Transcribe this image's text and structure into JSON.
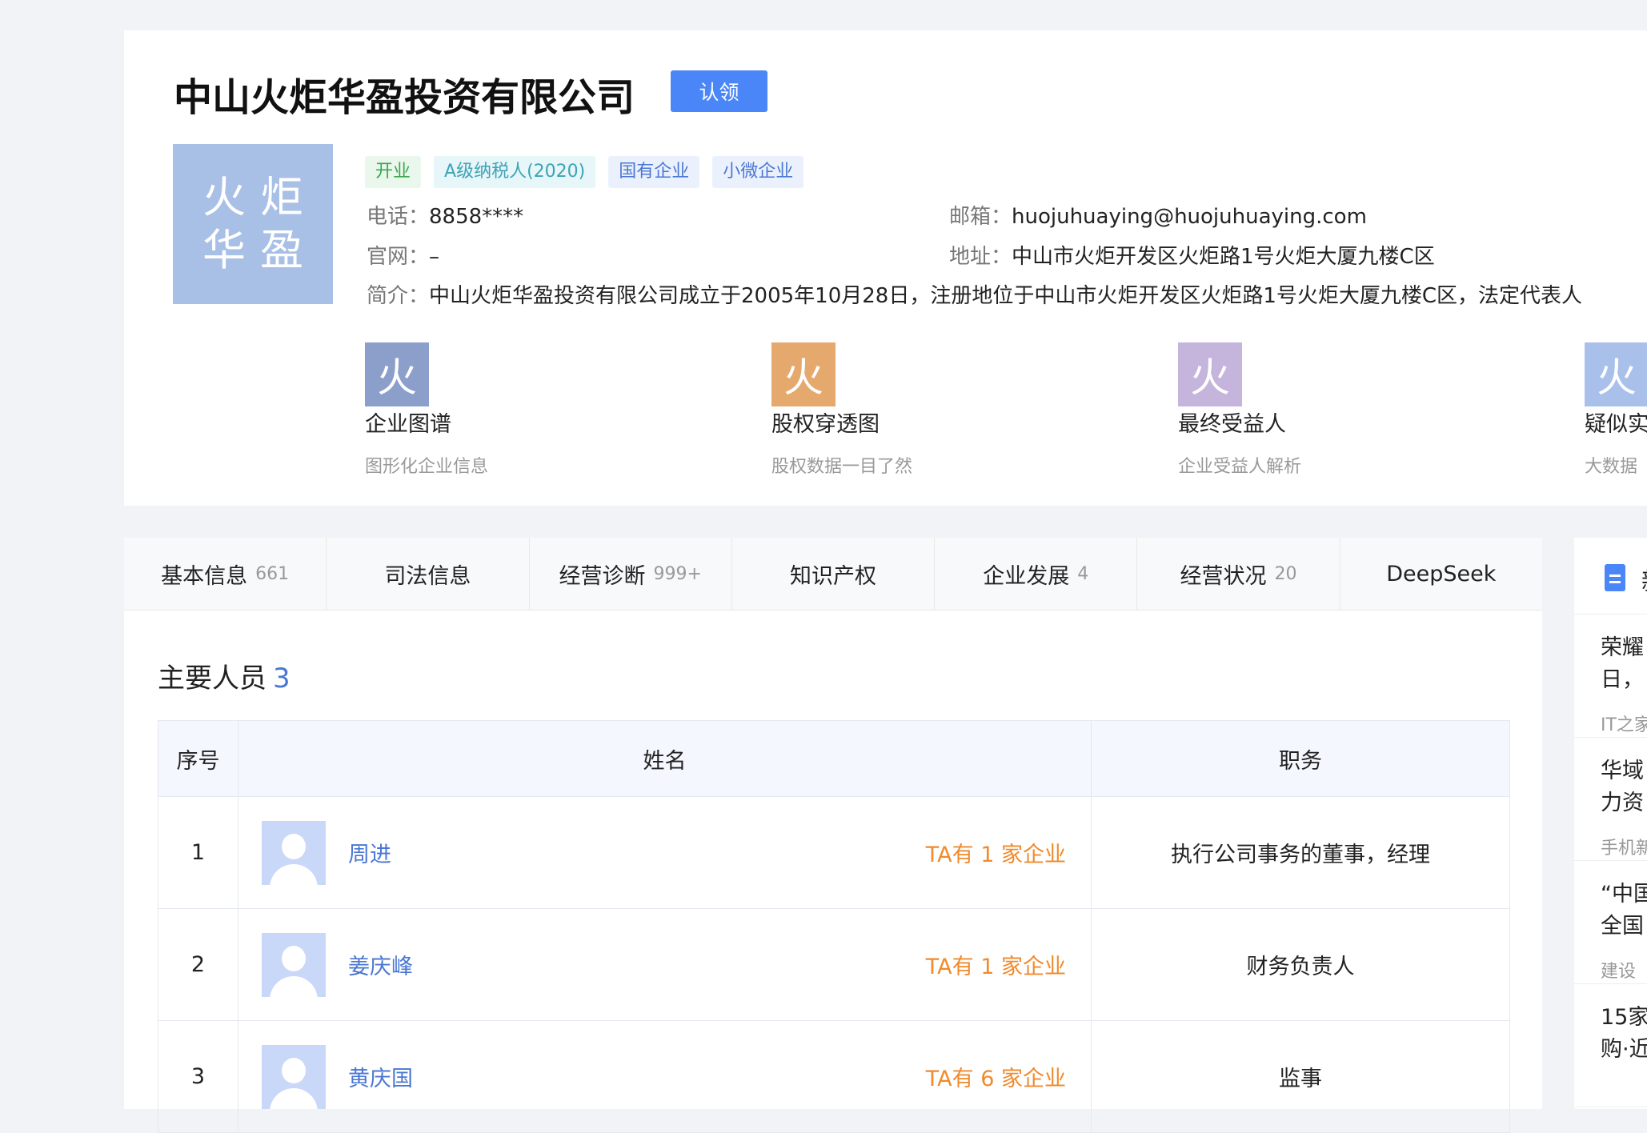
{
  "company": {
    "name": "中山火炬华盈投资有限公司",
    "claim_label": "认领",
    "logo_line1": "火炬",
    "logo_line2": "华盈",
    "tags": [
      "开业",
      "A级纳税人(2020)",
      "国有企业",
      "小微企业"
    ],
    "phone_label": "电话：",
    "phone": "8858****",
    "email_label": "邮箱：",
    "email": "huojuhuaying@huojuhuaying.com",
    "website_label": "官网：",
    "website": "–",
    "address_label": "地址：",
    "address": "中山市火炬开发区火炬路1号火炬大厦九楼C区",
    "intro_label": "简介：",
    "intro": "中山火炬华盈投资有限公司成立于2005年10月28日，注册地位于中山市火炬开发区火炬路1号火炬大厦九楼C区，法定代表人"
  },
  "features": [
    {
      "icon_char": "火",
      "color": "#8c9fcb",
      "name": "企业图谱",
      "desc": "图形化企业信息"
    },
    {
      "icon_char": "火",
      "color": "#e5a96d",
      "name": "股权穿透图",
      "desc": "股权数据一目了然"
    },
    {
      "icon_char": "火",
      "color": "#c5b4dc",
      "name": "最终受益人",
      "desc": "企业受益人解析"
    },
    {
      "icon_char": "火",
      "color": "#a8c0ea",
      "name": "疑似实",
      "desc": "大数据"
    }
  ],
  "tabs": [
    {
      "label": "基本信息",
      "count": "661"
    },
    {
      "label": "司法信息",
      "count": ""
    },
    {
      "label": "经营诊断",
      "count": "999+"
    },
    {
      "label": "知识产权",
      "count": ""
    },
    {
      "label": "企业发展",
      "count": "4"
    },
    {
      "label": "经营状况",
      "count": "20"
    },
    {
      "label": "DeepSeek",
      "count": ""
    }
  ],
  "key_people": {
    "title": "主要人员",
    "count": "3",
    "headers": {
      "index": "序号",
      "name": "姓名",
      "position": "职务"
    },
    "rows": [
      {
        "index": "1",
        "name": "周进",
        "companies": "TA有 1 家企业",
        "position": "执行公司事务的董事，经理"
      },
      {
        "index": "2",
        "name": "姜庆峰",
        "companies": "TA有 1 家企业",
        "position": "财务负责人"
      },
      {
        "index": "3",
        "name": "黄庆国",
        "companies": "TA有 6 家企业",
        "position": "监事"
      }
    ]
  },
  "news": {
    "title": "新",
    "items": [
      {
        "line1": "荣耀",
        "line2": "日，",
        "source": "IT之家"
      },
      {
        "line1": "华域",
        "line2": "力资",
        "source": "手机新"
      },
      {
        "line1": "“中国",
        "line2": "全国",
        "source": "建设"
      },
      {
        "line1": "15家",
        "line2": "购·近",
        "source": ""
      }
    ]
  }
}
